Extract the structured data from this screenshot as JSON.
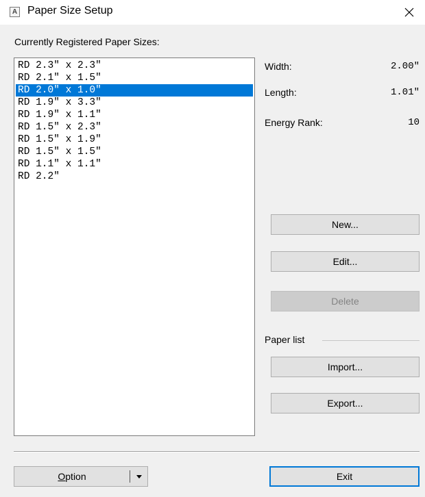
{
  "window": {
    "title": "Paper Size Setup",
    "icon_glyph": "A",
    "icons": {
      "app": "app-icon",
      "close": "close-icon"
    }
  },
  "list": {
    "label": "Currently Registered Paper Sizes:",
    "items": [
      "RD 2.3\" x 2.3\"",
      "RD 2.1\" x 1.5\"",
      "RD 2.0\" x 1.0\"",
      "RD 1.9\" x 3.3\"",
      "RD 1.9\" x 1.1\"",
      "RD 1.5\" x 2.3\"",
      "RD 1.5\" x 1.9\"",
      "RD 1.5\" x 1.5\"",
      "RD 1.1\" x 1.1\"",
      "RD 2.2\""
    ],
    "selected_index": 2
  },
  "details": {
    "width_label": "Width:",
    "width_value": "2.00\"",
    "length_label": "Length:",
    "length_value": "1.01\"",
    "energy_label": "Energy Rank:",
    "energy_value": "10"
  },
  "buttons": {
    "new": "New...",
    "edit": "Edit...",
    "delete": "Delete",
    "paper_list_label": "Paper list",
    "import": "Import...",
    "export": "Export...",
    "option_first": "O",
    "option_rest": "ption",
    "exit": "Exit"
  },
  "colors": {
    "selection": "#0078d7",
    "window_bg": "#f0f0f0"
  }
}
